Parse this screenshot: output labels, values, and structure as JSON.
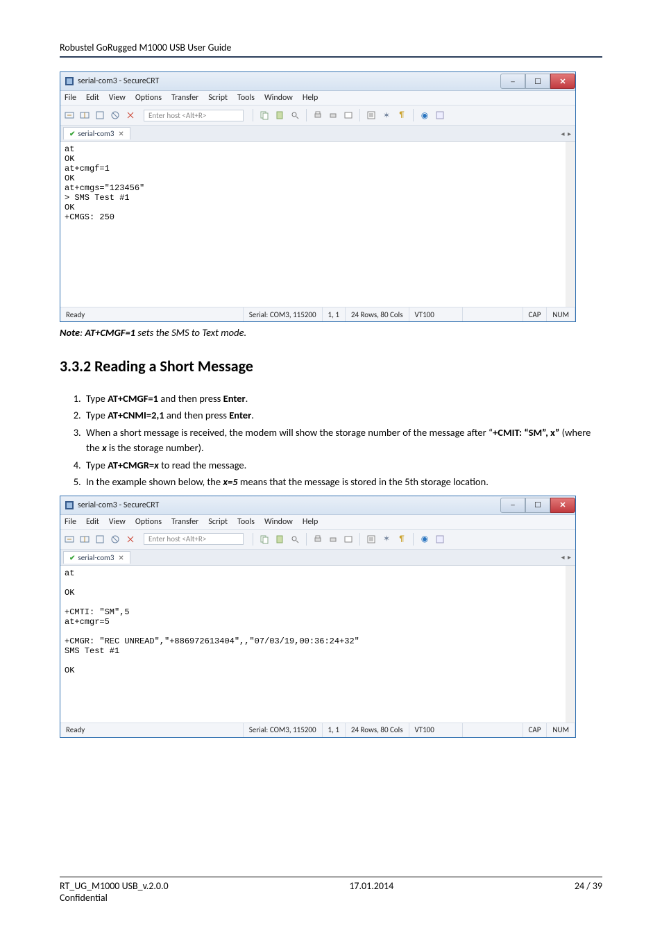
{
  "header": {
    "guide_title": "Robustel GoRugged M1000 USB User Guide"
  },
  "window1": {
    "title": "serial-com3 - SecureCRT",
    "menu": [
      "File",
      "Edit",
      "View",
      "Options",
      "Transfer",
      "Script",
      "Tools",
      "Window",
      "Help"
    ],
    "host_placeholder": "Enter host <Alt+R>",
    "tab_label": "serial-com3",
    "terminal_text": "at\nOK\nat+cmgf=1\nOK\nat+cmgs=\"123456\"\n> SMS Test #1\nOK\n+CMGS: 250\n",
    "status": {
      "ready": "Ready",
      "port": "Serial: COM3, 115200",
      "pos": "1,  1",
      "size": "24 Rows, 80 Cols",
      "term": "VT100",
      "cap": "CAP",
      "num": "NUM"
    }
  },
  "note1_prefix": "Note",
  "note1_cmd": "AT+CMGF=1",
  "note1_rest": " sets the SMS to Text mode.",
  "section_title": "3.3.2  Reading a Short Message",
  "steps": {
    "s1_a": "Type ",
    "s1_b": "AT+CMGF=1",
    "s1_c": " and then press ",
    "s1_d": "Enter",
    "s1_e": ".",
    "s2_a": "Type ",
    "s2_b": "AT+CNMI=2,1",
    "s2_c": " and then press ",
    "s2_d": "Enter",
    "s2_e": ".",
    "s3_a": "When a short message is received, the modem will show the storage number of the message after “",
    "s3_b": "+CMIT: “SM”, x”",
    "s3_c": " (where the ",
    "s3_d": "x",
    "s3_e": " is the storage number).",
    "s4_a": "Type ",
    "s4_b": "AT+CMGR=",
    "s4_c": "x",
    "s4_d": " to read the message.",
    "s5_a": "In the example shown below, the ",
    "s5_b": "x=5",
    "s5_c": " means that the message is stored in the 5th storage location."
  },
  "window2": {
    "title": "serial-com3 - SecureCRT",
    "menu": [
      "File",
      "Edit",
      "View",
      "Options",
      "Transfer",
      "Script",
      "Tools",
      "Window",
      "Help"
    ],
    "host_placeholder": "Enter host <Alt+R>",
    "tab_label": "serial-com3",
    "terminal_text": "at\n\nOK\n\n+CMTI: \"SM\",5\nat+cmgr=5\n\n+CMGR: \"REC UNREAD\",\"+886972613404\",,\"07/03/19,00:36:24+32\"\nSMS Test #1\n\nOK\n",
    "status": {
      "ready": "Ready",
      "port": "Serial: COM3, 115200",
      "pos": "1,  1",
      "size": "24 Rows, 80 Cols",
      "term": "VT100",
      "cap": "CAP",
      "num": "NUM"
    }
  },
  "footer": {
    "left": "RT_UG_M1000 USB_v.2.0.0",
    "center": "17.01.2014",
    "right": "24 / 39",
    "conf": "Confidential"
  }
}
